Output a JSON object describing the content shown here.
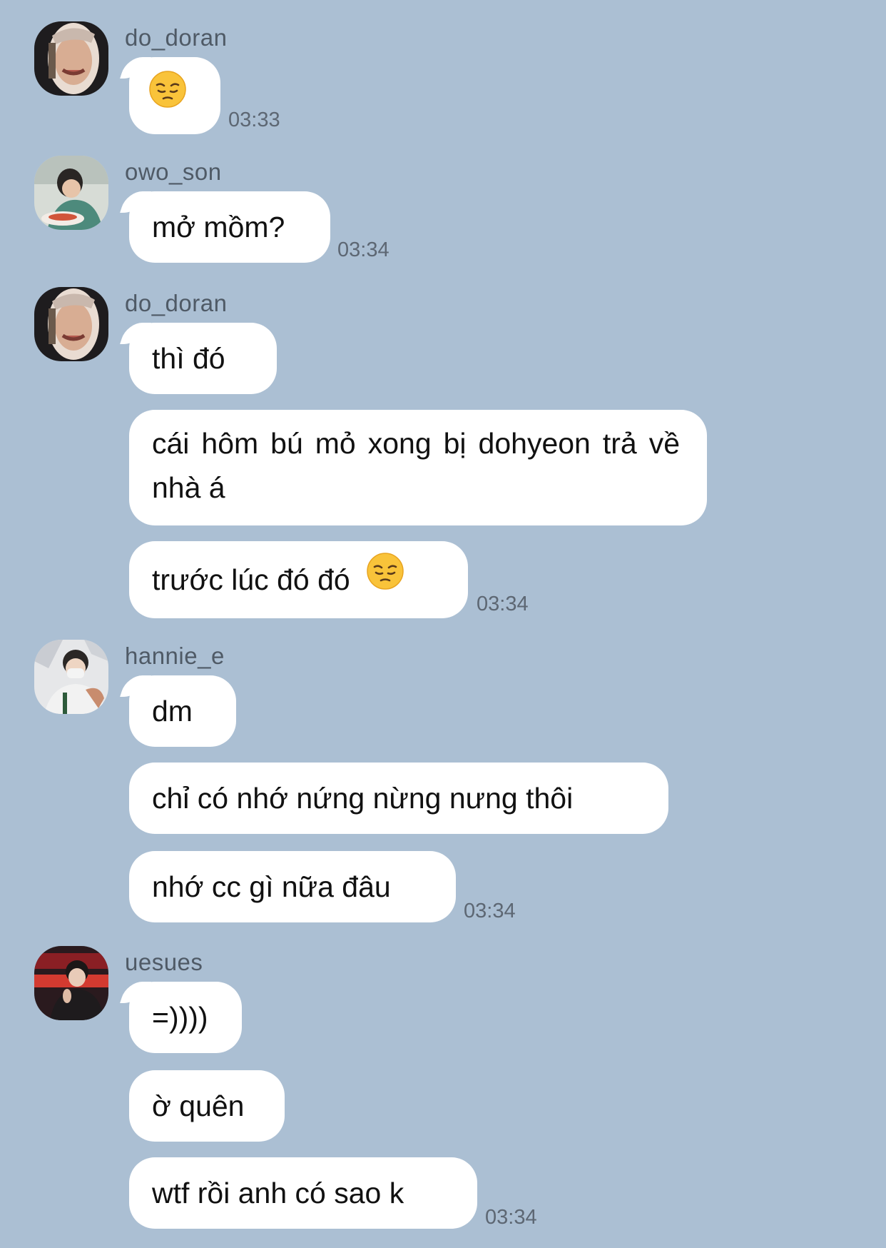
{
  "theme": {
    "background": "#abbfd3",
    "bubble": "#ffffff"
  },
  "groups": [
    {
      "sender": "do_doran",
      "avatar_icon": "avatar-do_doran-icon",
      "messages": [
        {
          "text": "",
          "emoji": "pensive-face-emoji"
        }
      ],
      "time": "03:33"
    },
    {
      "sender": "owo_son",
      "avatar_icon": "avatar-owo_son-icon",
      "messages": [
        {
          "text": "mở mồm?"
        }
      ],
      "time": "03:34"
    },
    {
      "sender": "do_doran",
      "avatar_icon": "avatar-do_doran-icon",
      "messages": [
        {
          "text": "thì đó"
        },
        {
          "text": "cái hôm bú mỏ xong bị dohyeon trả về nhà á"
        },
        {
          "text": "trước lúc đó đó",
          "emoji": "pensive-face-emoji"
        }
      ],
      "time": "03:34"
    },
    {
      "sender": "hannie_e",
      "avatar_icon": "avatar-hannie_e-icon",
      "messages": [
        {
          "text": "dm"
        },
        {
          "text": "chỉ có nhớ nứng nừng nưng thôi"
        },
        {
          "text": "nhớ cc gì nữa đâu"
        }
      ],
      "time": "03:34"
    },
    {
      "sender": "uesues",
      "avatar_icon": "avatar-uesues-icon",
      "messages": [
        {
          "text": "=))))"
        },
        {
          "text": "ờ quên"
        },
        {
          "text": "wtf rồi anh có sao k"
        }
      ],
      "time": "03:34"
    }
  ]
}
